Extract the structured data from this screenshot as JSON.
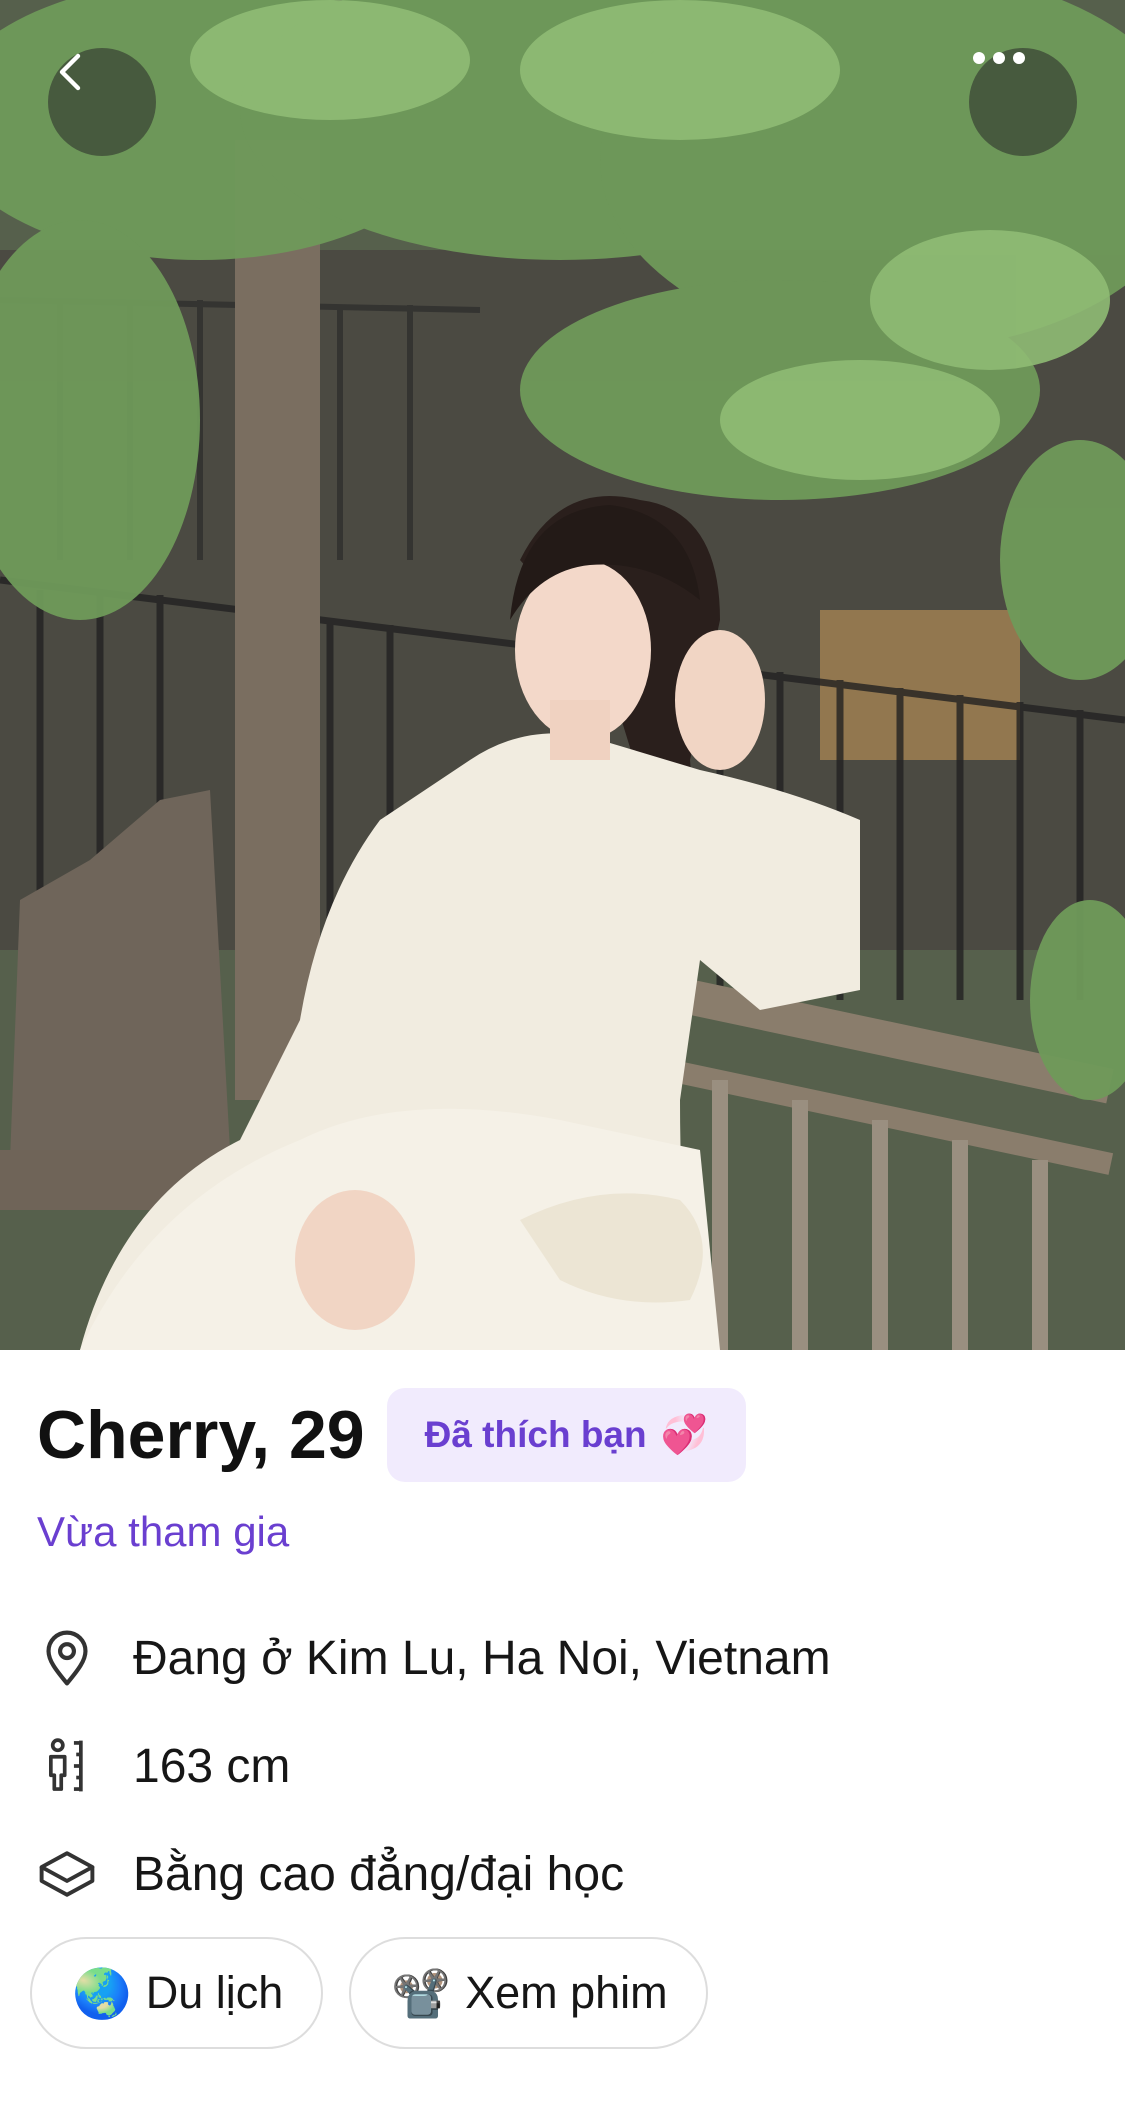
{
  "header": {
    "back_icon": "chevron-left-icon",
    "more_icon": "more-horizontal-icon"
  },
  "profile": {
    "name_age": "Cherry, 29",
    "liked_badge": "Đã thích bạn",
    "liked_emoji": "💞",
    "joined_status": "Vừa tham gia"
  },
  "details": [
    {
      "icon": "location-pin-icon",
      "text": "Đang ở Kim Lu, Ha Noi, Vietnam"
    },
    {
      "icon": "height-ruler-icon",
      "text": "163 cm"
    },
    {
      "icon": "graduation-cap-icon",
      "text": "Bằng cao đẳng/đại học"
    }
  ],
  "interests": [
    {
      "emoji": "🌏",
      "label": "Du lịch"
    },
    {
      "emoji": "📽️",
      "label": "Xem phim"
    }
  ],
  "colors": {
    "accent": "#6a3fd0",
    "badge_bg": "#f1ebfd",
    "text": "#111111",
    "chip_border": "#dddddd"
  }
}
